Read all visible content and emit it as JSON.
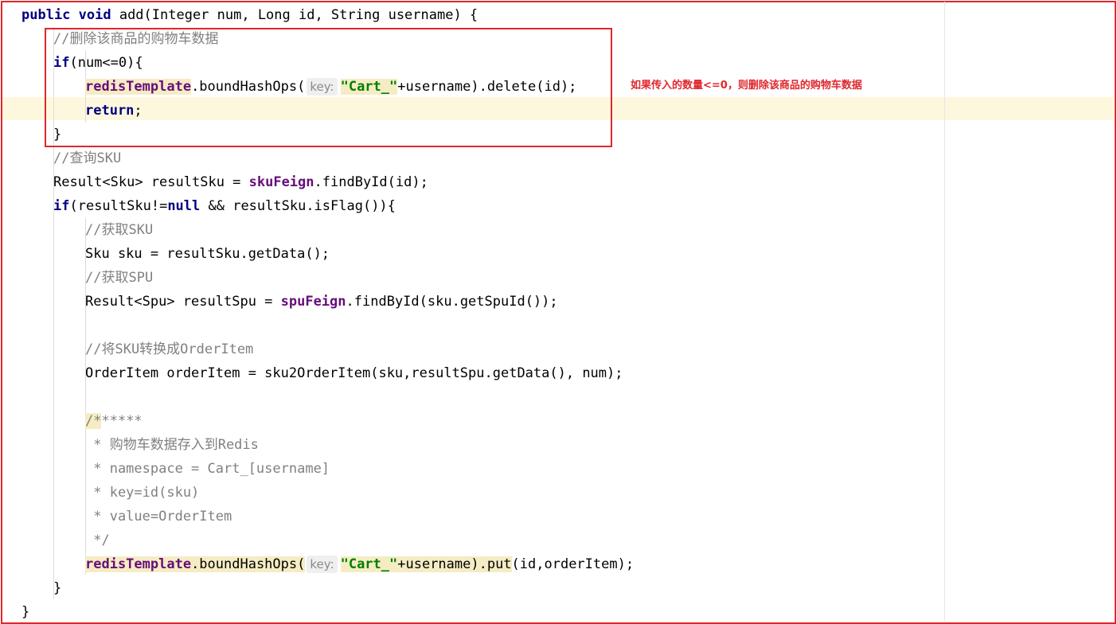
{
  "editor": {
    "lines": [
      {
        "indent": 0,
        "tokens": [
          {
            "t": "public void",
            "c": "kw"
          },
          {
            "t": " add(Integer num, Long id, String username) {",
            "c": ""
          }
        ]
      },
      {
        "indent": 1,
        "tokens": [
          {
            "t": "//删除该商品的购物车数据",
            "c": "cm"
          }
        ]
      },
      {
        "indent": 1,
        "tokens": [
          {
            "t": "if",
            "c": "kw"
          },
          {
            "t": "(num<=0){",
            "c": ""
          }
        ]
      },
      {
        "indent": 2,
        "tokens": [
          {
            "t": "redisTemplate",
            "c": "field hl"
          },
          {
            "t": ".boundHashOps(",
            "c": ""
          },
          {
            "t": "key:",
            "c": "hint"
          },
          {
            "t": "\"Cart_\"",
            "c": "str hl"
          },
          {
            "t": "+username).delete(id);",
            "c": ""
          }
        ]
      },
      {
        "indent": 2,
        "tokens": [
          {
            "t": "return",
            "c": "kw"
          },
          {
            "t": ";",
            "c": ""
          }
        ]
      },
      {
        "indent": 1,
        "tokens": [
          {
            "t": "}",
            "c": ""
          }
        ]
      },
      {
        "indent": 1,
        "tokens": [
          {
            "t": "//查询SKU",
            "c": "cm"
          }
        ]
      },
      {
        "indent": 1,
        "tokens": [
          {
            "t": "Result<Sku> resultSku = ",
            "c": ""
          },
          {
            "t": "skuFeign",
            "c": "field"
          },
          {
            "t": ".findById(id);",
            "c": ""
          }
        ]
      },
      {
        "indent": 1,
        "tokens": [
          {
            "t": "if",
            "c": "kw"
          },
          {
            "t": "(resultSku!=",
            "c": ""
          },
          {
            "t": "null",
            "c": "kw"
          },
          {
            "t": " && resultSku.isFlag()){",
            "c": ""
          }
        ]
      },
      {
        "indent": 2,
        "tokens": [
          {
            "t": "//获取SKU",
            "c": "cm"
          }
        ]
      },
      {
        "indent": 2,
        "tokens": [
          {
            "t": "Sku sku = resultSku.getData();",
            "c": ""
          }
        ]
      },
      {
        "indent": 2,
        "tokens": [
          {
            "t": "//获取SPU",
            "c": "cm"
          }
        ]
      },
      {
        "indent": 2,
        "tokens": [
          {
            "t": "Result<Spu> resultSpu = ",
            "c": ""
          },
          {
            "t": "spuFeign",
            "c": "field"
          },
          {
            "t": ".findById(sku.getSpuId());",
            "c": ""
          }
        ]
      },
      {
        "indent": 2,
        "tokens": []
      },
      {
        "indent": 2,
        "tokens": [
          {
            "t": "//将SKU转换成OrderItem",
            "c": "cm"
          }
        ]
      },
      {
        "indent": 2,
        "tokens": [
          {
            "t": "OrderItem orderItem = sku2OrderItem(sku,resultSpu.getData(), num);",
            "c": ""
          }
        ]
      },
      {
        "indent": 2,
        "tokens": []
      },
      {
        "indent": 2,
        "tokens": [
          {
            "t": "/*",
            "c": "cm hl"
          },
          {
            "t": "*****",
            "c": "cm"
          }
        ]
      },
      {
        "indent": 2,
        "tokens": [
          {
            "t": " * 购物车数据存入到Redis",
            "c": "cm"
          }
        ]
      },
      {
        "indent": 2,
        "tokens": [
          {
            "t": " * namespace = Cart_[username]",
            "c": "cm"
          }
        ]
      },
      {
        "indent": 2,
        "tokens": [
          {
            "t": " * key=id(sku)",
            "c": "cm"
          }
        ]
      },
      {
        "indent": 2,
        "tokens": [
          {
            "t": " * value=OrderItem",
            "c": "cm"
          }
        ]
      },
      {
        "indent": 2,
        "tokens": [
          {
            "t": " */",
            "c": "cm"
          }
        ]
      },
      {
        "indent": 2,
        "tokens": [
          {
            "t": "redisTemplate",
            "c": "field hl"
          },
          {
            "t": ".boundHashOps(",
            "c": "hl"
          },
          {
            "t": "key:",
            "c": "hint"
          },
          {
            "t": "\"Cart_\"",
            "c": "str hl"
          },
          {
            "t": "+username).put",
            "c": "hl"
          },
          {
            "t": "(id,orderItem);",
            "c": ""
          }
        ]
      },
      {
        "indent": 1,
        "tokens": [
          {
            "t": "}",
            "c": ""
          }
        ]
      },
      {
        "indent": 0,
        "tokens": [
          {
            "t": "}",
            "c": ""
          }
        ]
      }
    ]
  },
  "annotation": {
    "text": "如果传入的数量<=0，则删除该商品的购物车数据"
  },
  "colors": {
    "accent_red": "#e0262d",
    "keyword": "#000080",
    "field": "#660e7a",
    "string": "#008000",
    "comment": "#808080"
  }
}
